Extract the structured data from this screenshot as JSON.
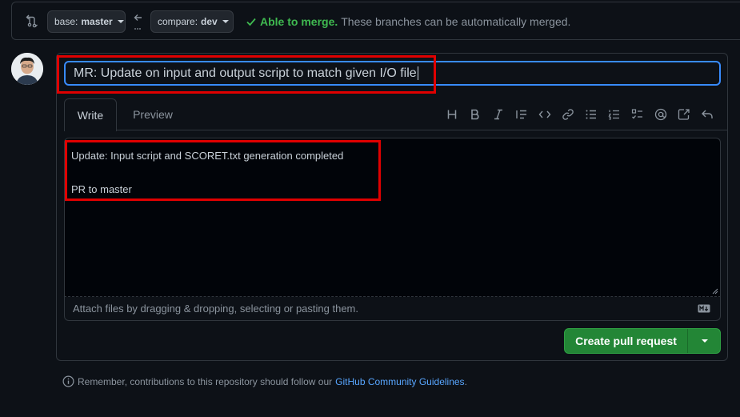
{
  "compare": {
    "base_label": "base:",
    "base_value": "master",
    "compare_label": "compare:",
    "compare_value": "dev",
    "status_ok": "Able to merge.",
    "status_desc": "These branches can be automatically merged.",
    "status_color": "#3fb950"
  },
  "pr": {
    "title_value": "MR: Update on input and output script to match given I/O file",
    "tabs": [
      {
        "label": "Write",
        "active": true
      },
      {
        "label": "Preview",
        "active": false
      }
    ],
    "toolbar": [
      "heading-icon",
      "bold-icon",
      "italic-icon",
      "quote-icon",
      "code-icon",
      "link-icon",
      "unordered-list-icon",
      "ordered-list-icon",
      "task-list-icon",
      "mention-icon",
      "cross-reference-icon",
      "reply-icon"
    ],
    "body_lines": [
      "Update: Input script and SCORET.txt generation completed",
      "",
      "PR to master"
    ],
    "attach_hint": "Attach files by dragging & dropping, selecting or pasting them.",
    "create_label": "Create pull request"
  },
  "footer": {
    "note_prefix": "Remember, contributions to this repository should follow our",
    "link_text": "GitHub Community Guidelines",
    "note_suffix": "."
  },
  "colors": {
    "accent": "#388bfd",
    "primary_button": "#238636",
    "annotation": "#e00000"
  }
}
